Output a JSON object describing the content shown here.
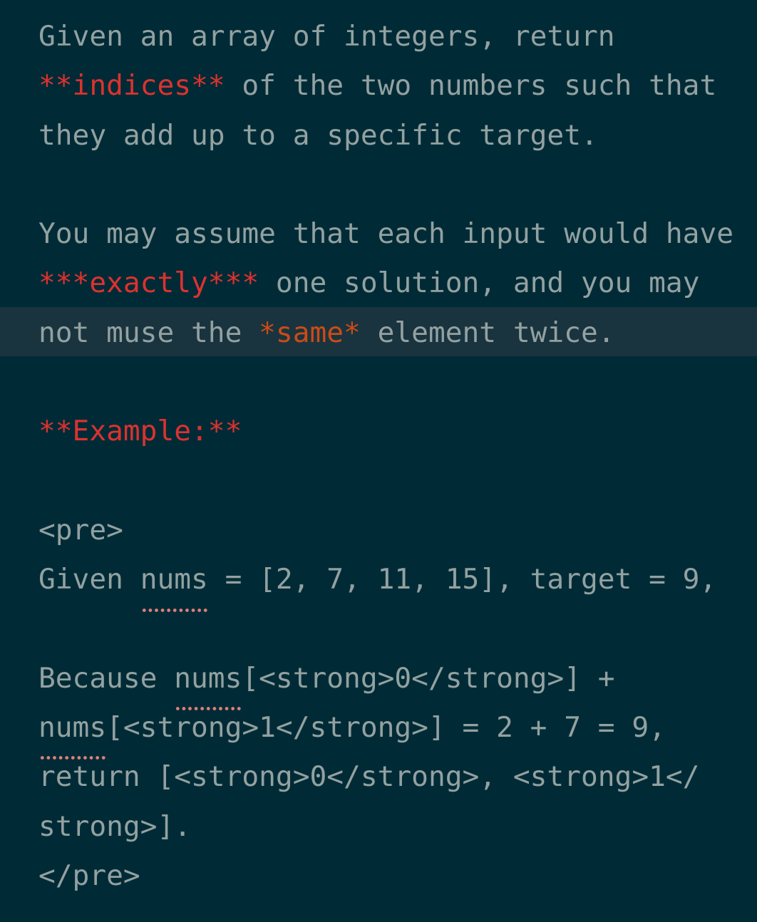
{
  "editor": {
    "name": "markdown-source-editor",
    "colors": {
      "background": "#002b36",
      "current_line_background": "#19343f",
      "foreground": "#93a1a1",
      "emphasis_red": "#dc322f",
      "emphasis_orange": "#cb4b16",
      "spellcheck_underline": "#e2807c"
    },
    "current_line_index": 6,
    "lines": [
      {
        "index": 0,
        "text": "Given an array of integers, return",
        "tokens": [
          {
            "text": "Given an array of integers, return",
            "style": "plain"
          }
        ]
      },
      {
        "index": 1,
        "text": "**indices** of the two numbers such that",
        "tokens": [
          {
            "text": "**indices**",
            "style": "red"
          },
          {
            "text": " of the two numbers such that",
            "style": "plain"
          }
        ]
      },
      {
        "index": 2,
        "text": "they add up to a specific target.",
        "tokens": [
          {
            "text": "they add up to a specific target.",
            "style": "plain"
          }
        ]
      },
      {
        "index": 3,
        "text": "",
        "tokens": []
      },
      {
        "index": 4,
        "text": "You may assume that each input would have",
        "tokens": [
          {
            "text": "You may assume that each input would have",
            "style": "plain"
          }
        ]
      },
      {
        "index": 5,
        "text": "***exactly*** one solution, and you may",
        "tokens": [
          {
            "text": "***exactly***",
            "style": "red"
          },
          {
            "text": " one solution, and you may",
            "style": "plain"
          }
        ]
      },
      {
        "index": 6,
        "text": "not muse the *same* element twice.",
        "tokens": [
          {
            "text": "not muse the ",
            "style": "plain"
          },
          {
            "text": "*same*",
            "style": "orange"
          },
          {
            "text": " element twice.",
            "style": "plain"
          }
        ]
      },
      {
        "index": 7,
        "text": "",
        "tokens": []
      },
      {
        "index": 8,
        "text": "**Example:**",
        "tokens": [
          {
            "text": "**Example:**",
            "style": "red"
          }
        ]
      },
      {
        "index": 9,
        "text": "",
        "tokens": []
      },
      {
        "index": 10,
        "text": "<pre>",
        "tokens": [
          {
            "text": "<pre>",
            "style": "plain"
          }
        ]
      },
      {
        "index": 11,
        "text": "Given nums = [2, 7, 11, 15], target = 9,",
        "tokens": [
          {
            "text": "Given ",
            "style": "plain"
          },
          {
            "text": "nums",
            "style": "plain",
            "spellcheck": true
          },
          {
            "text": " = [2, 7, 11, 15], target = 9,",
            "style": "plain"
          }
        ]
      },
      {
        "index": 12,
        "text": "",
        "tokens": []
      },
      {
        "index": 13,
        "text": "Because nums[<strong>0</strong>] +",
        "tokens": [
          {
            "text": "Because ",
            "style": "plain"
          },
          {
            "text": "nums",
            "style": "plain",
            "spellcheck": true
          },
          {
            "text": "[<strong>0</strong>] +",
            "style": "plain"
          }
        ]
      },
      {
        "index": 14,
        "text": "nums[<strong>1</strong>] = 2 + 7 = 9,",
        "tokens": [
          {
            "text": "nums",
            "style": "plain",
            "spellcheck": true
          },
          {
            "text": "[<strong>1</strong>] = 2 + 7 = 9,",
            "style": "plain"
          }
        ]
      },
      {
        "index": 15,
        "text": "return [<strong>0</strong>, <strong>1</",
        "tokens": [
          {
            "text": "return [<strong>0</strong>, <strong>1</",
            "style": "plain"
          }
        ]
      },
      {
        "index": 16,
        "text": "strong>].",
        "tokens": [
          {
            "text": "strong>].",
            "style": "plain"
          }
        ]
      },
      {
        "index": 17,
        "text": "</pre>",
        "tokens": [
          {
            "text": "</pre>",
            "style": "plain"
          }
        ]
      }
    ]
  }
}
